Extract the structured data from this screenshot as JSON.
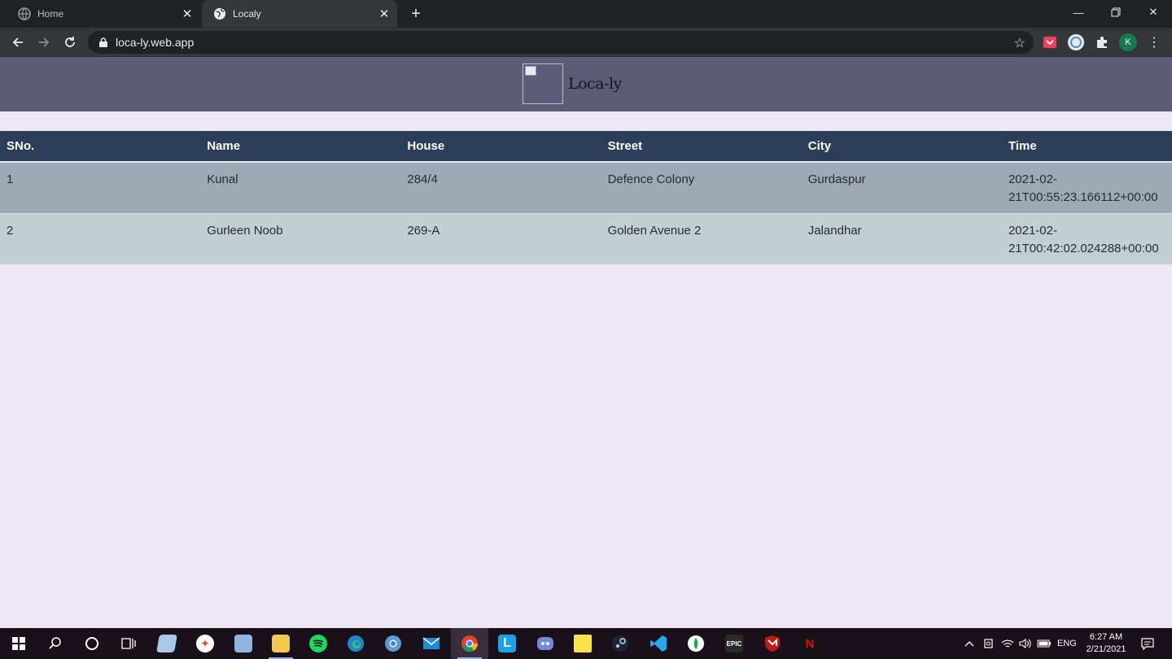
{
  "browser": {
    "tabs": [
      {
        "title": "Home",
        "active": false
      },
      {
        "title": "Localy",
        "active": true
      }
    ],
    "url": "loca-ly.web.app",
    "profile_initial": "K"
  },
  "page": {
    "site_title": "Loca-ly",
    "table": {
      "headers": [
        "SNo.",
        "Name",
        "House",
        "Street",
        "City",
        "Time"
      ],
      "rows": [
        {
          "sno": "1",
          "name": "Kunal",
          "house": "284/4",
          "street": "Defence Colony",
          "city": "Gurdaspur",
          "time_line1": "2021-02-",
          "time_line2": "21T00:55:23.166112+00:00"
        },
        {
          "sno": "2",
          "name": "Gurleen Noob",
          "house": "269-A",
          "street": "Golden Avenue 2",
          "city": "Jalandhar",
          "time_line1": "2021-02-",
          "time_line2": "21T00:42:02.024288+00:00"
        }
      ]
    }
  },
  "taskbar": {
    "language": "ENG",
    "time": "6:27 AM",
    "date": "2/21/2021",
    "epic_label": "EPIC",
    "launcher_label": "L",
    "netflix_label": "N"
  },
  "colors": {
    "header_bg": "#5d5b77",
    "table_header_bg": "#2c3e57",
    "row1_bg": "#9ea9b6",
    "row2_bg": "#c2cfd3",
    "page_bg": "#ede7f3"
  }
}
